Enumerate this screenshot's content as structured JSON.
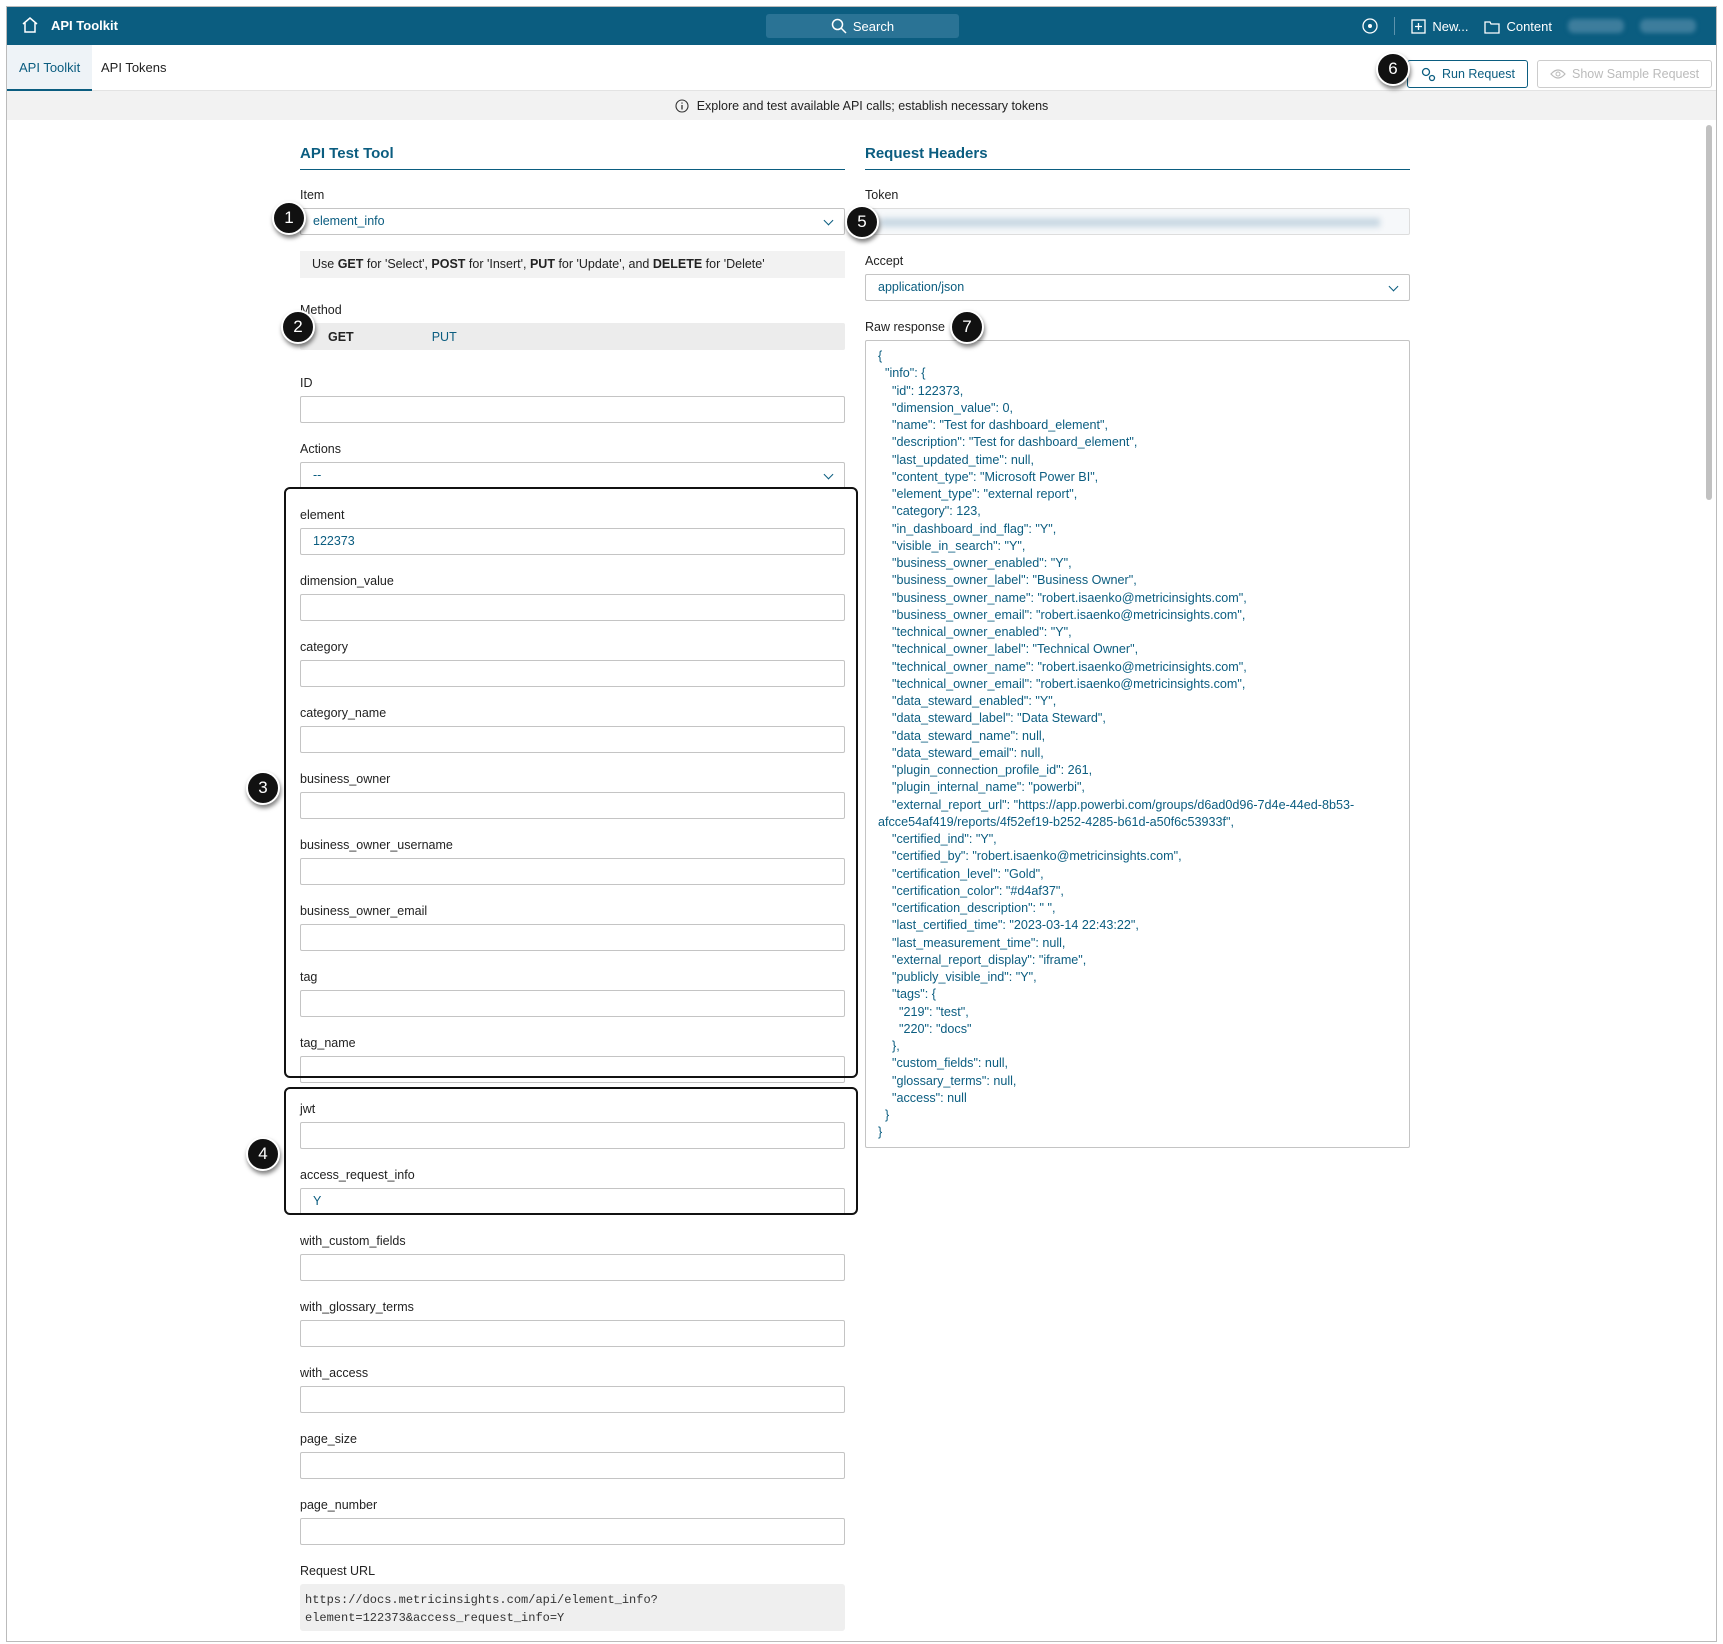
{
  "topbar": {
    "app_title": "API Toolkit",
    "search_label": "Search",
    "new_label": "New...",
    "content_label": "Content"
  },
  "tabs": [
    {
      "label": "API Toolkit"
    },
    {
      "label": "API Tokens"
    }
  ],
  "toolbar": {
    "run_label": "Run Request",
    "sample_label": "Show Sample Request"
  },
  "info_text": "Explore and test available API calls; establish necessary tokens",
  "left": {
    "title": "API Test Tool",
    "item_label": "Item",
    "item_value": "element_info",
    "hint": {
      "p1": "Use ",
      "b1": "GET",
      "p2": " for 'Select', ",
      "b2": "POST",
      "p3": " for 'Insert', ",
      "b3": "PUT",
      "p4": " for 'Update', and ",
      "b4": "DELETE",
      "p5": " for 'Delete'"
    },
    "method_label": "Method",
    "methods": [
      "GET",
      "PUT"
    ],
    "fields": [
      {
        "label": "ID",
        "value": ""
      },
      {
        "label": "Actions",
        "value": "--"
      },
      {
        "label": "element",
        "value": "122373"
      },
      {
        "label": "dimension_value",
        "value": ""
      },
      {
        "label": "category",
        "value": ""
      },
      {
        "label": "category_name",
        "value": ""
      },
      {
        "label": "business_owner",
        "value": ""
      },
      {
        "label": "business_owner_username",
        "value": ""
      },
      {
        "label": "business_owner_email",
        "value": ""
      },
      {
        "label": "tag",
        "value": ""
      },
      {
        "label": "tag_name",
        "value": ""
      },
      {
        "label": "jwt",
        "value": ""
      },
      {
        "label": "access_request_info",
        "value": "Y"
      },
      {
        "label": "with_custom_fields",
        "value": ""
      },
      {
        "label": "with_glossary_terms",
        "value": ""
      },
      {
        "label": "with_access",
        "value": ""
      },
      {
        "label": "page_size",
        "value": ""
      },
      {
        "label": "page_number",
        "value": ""
      }
    ],
    "request_url_label": "Request URL",
    "request_url": "https://docs.metricinsights.com/api/element_info?\nelement=122373&access_request_info=Y"
  },
  "right": {
    "title": "Request Headers",
    "token_label": "Token",
    "accept_label": "Accept",
    "accept_value": "application/json",
    "raw_label": "Raw response",
    "raw_response": "{\n  \"info\": {\n    \"id\": 122373,\n    \"dimension_value\": 0,\n    \"name\": \"Test for dashboard_element\",\n    \"description\": \"Test for dashboard_element\",\n    \"last_updated_time\": null,\n    \"content_type\": \"Microsoft Power BI\",\n    \"element_type\": \"external report\",\n    \"category\": 123,\n    \"in_dashboard_ind_flag\": \"Y\",\n    \"visible_in_search\": \"Y\",\n    \"business_owner_enabled\": \"Y\",\n    \"business_owner_label\": \"Business Owner\",\n    \"business_owner_name\": \"robert.isaenko@metricinsights.com\",\n    \"business_owner_email\": \"robert.isaenko@metricinsights.com\",\n    \"technical_owner_enabled\": \"Y\",\n    \"technical_owner_label\": \"Technical Owner\",\n    \"technical_owner_name\": \"robert.isaenko@metricinsights.com\",\n    \"technical_owner_email\": \"robert.isaenko@metricinsights.com\",\n    \"data_steward_enabled\": \"Y\",\n    \"data_steward_label\": \"Data Steward\",\n    \"data_steward_name\": null,\n    \"data_steward_email\": null,\n    \"plugin_connection_profile_id\": 261,\n    \"plugin_internal_name\": \"powerbi\",\n    \"external_report_url\": \"https://app.powerbi.com/groups/d6ad0d96-7d4e-44ed-8b53-\nafcce54af419/reports/4f52ef19-b252-4285-b61d-a50f6c53933f\",\n    \"certified_ind\": \"Y\",\n    \"certified_by\": \"robert.isaenko@metricinsights.com\",\n    \"certification_level\": \"Gold\",\n    \"certification_color\": \"#d4af37\",\n    \"certification_description\": \" \",\n    \"last_certified_time\": \"2023-03-14 22:43:22\",\n    \"last_measurement_time\": null,\n    \"external_report_display\": \"iframe\",\n    \"publicly_visible_ind\": \"Y\",\n    \"tags\": {\n      \"219\": \"test\",\n      \"220\": \"docs\"\n    },\n    \"custom_fields\": null,\n    \"glossary_terms\": null,\n    \"access\": null\n  }\n}"
  },
  "callouts": [
    "1",
    "2",
    "3",
    "4",
    "5",
    "6",
    "7"
  ],
  "colors": {
    "brand": "#0b5d80",
    "annotation": "#111111"
  }
}
